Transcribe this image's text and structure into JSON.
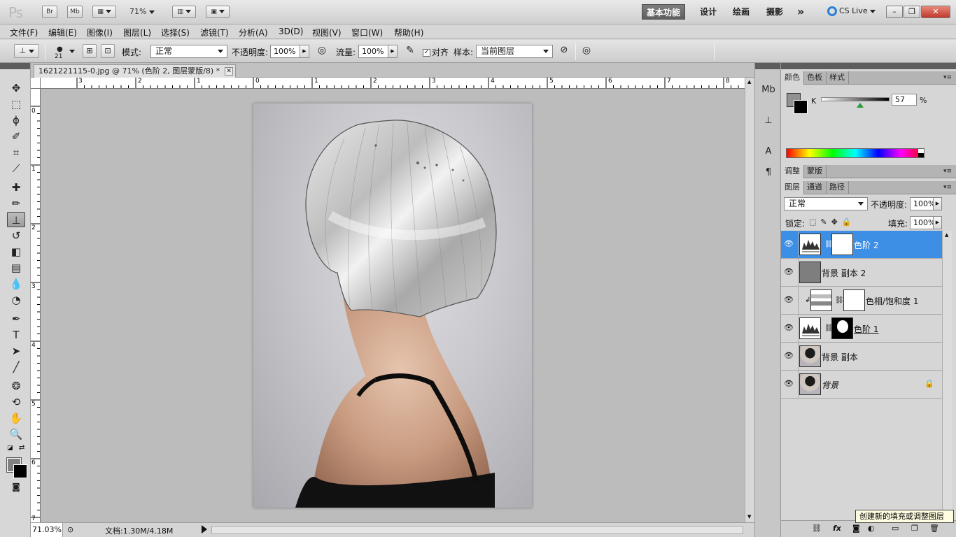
{
  "app": {
    "logo": "Ps",
    "bridge_label": "Br",
    "minibridge_label": "Mb",
    "zoom_level": "71%",
    "workspaces": [
      "基本功能",
      "设计",
      "绘画",
      "摄影"
    ],
    "active_workspace": "基本功能",
    "more_label": "»",
    "cslive_label": "CS Live",
    "window_controls": [
      "–",
      "❐",
      "✕"
    ]
  },
  "menu": [
    "文件(F)",
    "编辑(E)",
    "图像(I)",
    "图层(L)",
    "选择(S)",
    "滤镜(T)",
    "分析(A)",
    "3D(D)",
    "视图(V)",
    "窗口(W)",
    "帮助(H)"
  ],
  "options": {
    "brush_size": "21",
    "mode_label": "模式:",
    "mode_value": "正常",
    "opacity_label": "不透明度:",
    "opacity_value": "100%",
    "flow_label": "流量:",
    "flow_value": "100%",
    "aligned_label": "对齐",
    "aligned_checked": true,
    "sample_label": "样本:",
    "sample_value": "当前图层"
  },
  "document": {
    "tab_title": "1621221115-0.jpg @ 71% (色阶 2, 图层蒙版/8) *",
    "close_label": "✕",
    "ruler_h": [
      "3",
      "2",
      "1",
      "0",
      "1",
      "2",
      "3",
      "4",
      "5",
      "6",
      "7",
      "8"
    ],
    "ruler_v": [
      "0",
      "1",
      "2",
      "3",
      "4",
      "5",
      "6",
      "7"
    ]
  },
  "status": {
    "zoom": "71.03%",
    "doc_info": "文档:1.30M/4.18M"
  },
  "color_panel": {
    "tabs": [
      "颜色",
      "色板",
      "样式"
    ],
    "channel_label": "K",
    "value": "57",
    "unit": "%",
    "k_fraction": 0.57,
    "fg_color": "#919191",
    "bg_color": "#000000"
  },
  "adjust_panel": {
    "tabs": [
      "调整",
      "蒙版"
    ]
  },
  "layers_panel": {
    "tabs": [
      "图层",
      "通道",
      "路径"
    ],
    "blend_mode": "正常",
    "opacity_label": "不透明度:",
    "opacity_value": "100%",
    "lock_label": "锁定:",
    "fill_label": "填充:",
    "fill_value": "100%",
    "layers": [
      {
        "name": "色阶 2",
        "selected": true
      },
      {
        "name": "背景 副本 2",
        "selected": false
      },
      {
        "name": "色相/饱和度 1",
        "selected": false
      },
      {
        "name": "色阶 1",
        "selected": false
      },
      {
        "name": "背景 副本",
        "selected": false
      },
      {
        "name": "背景",
        "selected": false
      }
    ],
    "tooltip": "创建新的填充或调整图层"
  }
}
